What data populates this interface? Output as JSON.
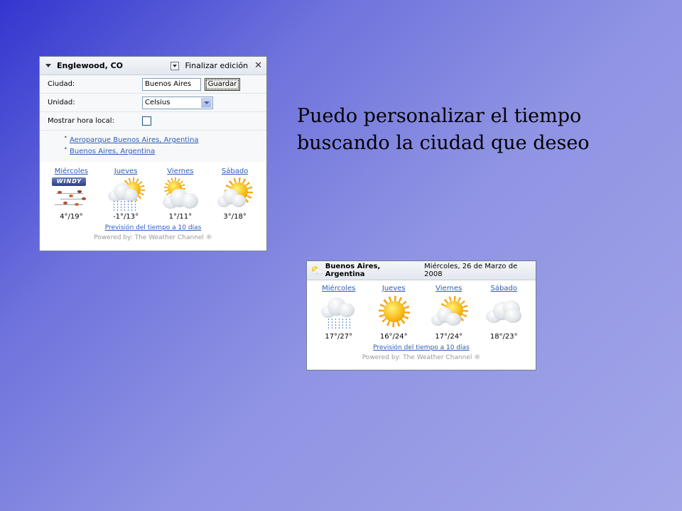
{
  "widget_edit": {
    "city": "Englewood, CO",
    "finish_label": "Finalizar edición",
    "form": {
      "city_label": "Ciudad:",
      "city_value": "Buenos Aires",
      "save_label": "Guardar",
      "unit_label": "Unidad:",
      "unit_value": "Celsius",
      "local_time_label": "Mostrar hora local:"
    },
    "results": [
      "Aeroparque Buenos Aires, Argentina",
      "Buenos Aires, Argentina"
    ],
    "forecast": [
      {
        "day": "Miércoles",
        "temp": "4°/19°",
        "icon": "windy-icon",
        "badge": "WINDY"
      },
      {
        "day": "Jueves",
        "temp": "-1°/13°",
        "icon": "rain-partly-sunny-icon"
      },
      {
        "day": "Viernes",
        "temp": "1°/11°",
        "icon": "cloudy-sun-icon"
      },
      {
        "day": "Sábado",
        "temp": "3°/18°",
        "icon": "partly-sunny-icon"
      }
    ],
    "ten_day_link": "Previsión del tiempo a 10 días",
    "powered_by": "Powered by: The Weather Channel ®"
  },
  "caption": "Puedo personalizar el tiempo buscando la ciudad que deseo",
  "widget_result": {
    "city": "Buenos Aires, Argentina",
    "date": "Miércoles, 26 de Marzo de 2008",
    "forecast": [
      {
        "day": "Miércoles",
        "temp": "17°/27°",
        "icon": "rain-icon"
      },
      {
        "day": "Jueves",
        "temp": "16°/24°",
        "icon": "sunny-icon"
      },
      {
        "day": "Viernes",
        "temp": "17°/24°",
        "icon": "partly-sunny-icon"
      },
      {
        "day": "Sábado",
        "temp": "18°/23°",
        "icon": "cloudy-icon"
      }
    ],
    "ten_day_link": "Previsión del tiempo a 10 días",
    "powered_by": "Powered by: The Weather Channel ®"
  }
}
